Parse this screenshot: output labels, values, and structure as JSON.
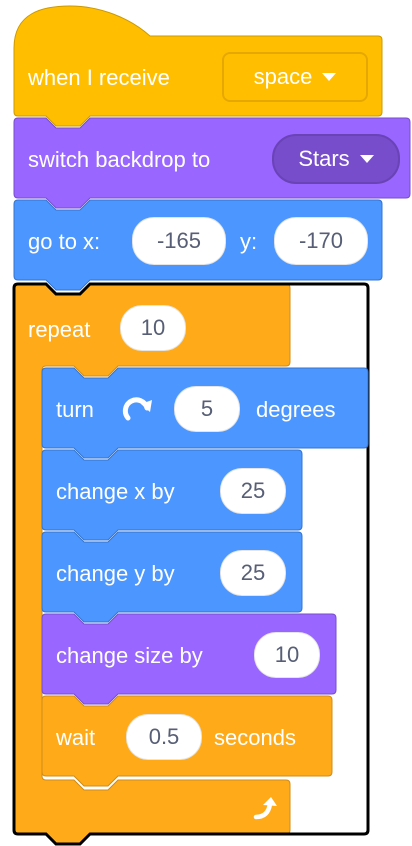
{
  "hat": {
    "label": "when I receive",
    "message": "space"
  },
  "backdrop": {
    "label": "switch backdrop to",
    "value": "Stars"
  },
  "goto": {
    "label_x": "go to x:",
    "x": "-165",
    "label_y": "y:",
    "y": "-170"
  },
  "repeat": {
    "label": "repeat",
    "count": "10"
  },
  "turn": {
    "label": "turn",
    "degrees": "5",
    "suffix": "degrees",
    "icon": "rotate-right-icon"
  },
  "changex": {
    "label": "change x by",
    "value": "25"
  },
  "changey": {
    "label": "change y by",
    "value": "25"
  },
  "changesize": {
    "label": "change size by",
    "value": "10"
  },
  "wait": {
    "label": "wait",
    "value": "0.5",
    "suffix": "seconds"
  },
  "loop_icon": "loop-arrow-icon",
  "colors": {
    "events": "#ffbf00",
    "looks": "#9966ff",
    "motion": "#4c97ff",
    "control": "#ffab19"
  }
}
